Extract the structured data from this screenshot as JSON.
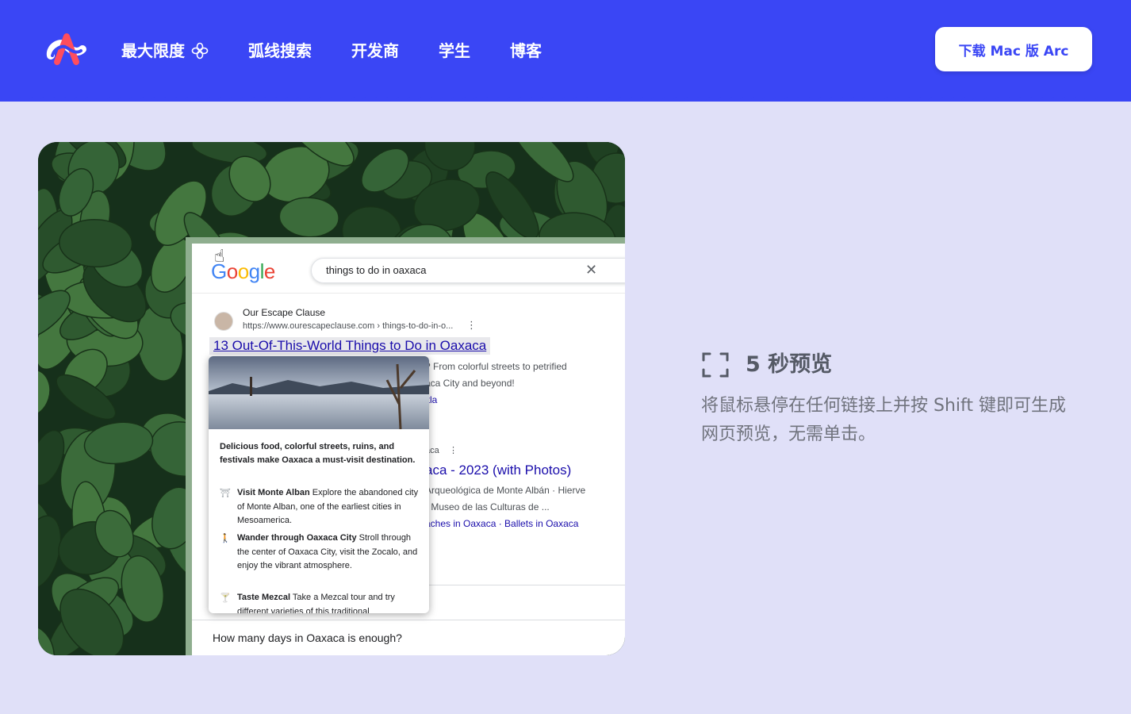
{
  "header": {
    "brand_color": "#3a46f5",
    "nav": [
      {
        "label": "最大限度",
        "icon": "sparkle-icon"
      },
      {
        "label": "弧线搜索"
      },
      {
        "label": "开发商"
      },
      {
        "label": "学生"
      },
      {
        "label": "博客"
      }
    ],
    "download_label": "下载 Mac 版 Arc"
  },
  "screenshot": {
    "search_engine": "Google",
    "query": "things to do in oaxaca",
    "result1": {
      "site_name": "Our Escape Clause",
      "url": "https://www.ourescapeclause.com › things-to-do-in-o...",
      "title": "13 Out-Of-This-World Things to Do in Oaxaca",
      "snippet_line1": "? From colorful streets to petrified",
      "snippet_line2": "aca City and beyond!",
      "snippet_link": "itla"
    },
    "result2": {
      "site_fragment": "aca",
      "title": "aca - 2023 (with Photos)",
      "snippet_line1": "Arqueológica de Monte Albán · Hierve",
      "snippet_line2": "· Museo de las Culturas de ...",
      "links": "aches in Oaxaca · Ballets in Oaxaca"
    },
    "faq_question": "How many days in Oaxaca is enough?",
    "preview": {
      "lead": "Delicious food, colorful streets, ruins, and festivals make Oaxaca a must-visit destination.",
      "items": [
        {
          "title": "Visit Monte Alban",
          "text": "Explore the abandoned city of Monte Alban, one of the earliest cities in Mesoamerica.",
          "icon": "monument-icon"
        },
        {
          "title": "Wander through Oaxaca City",
          "text": "Stroll through the center of Oaxaca City, visit the Zocalo, and enjoy the vibrant atmosphere.",
          "icon": "walking-icon"
        },
        {
          "title": "Taste Mezcal",
          "text": "Take a Mezcal tour and try different varieties of this traditional",
          "icon": "drink-icon"
        }
      ]
    }
  },
  "feature": {
    "icon": "frame-corners-icon",
    "title": "5 秒预览",
    "description": "将鼠标悬停在任何链接上并按 Shift 键即可生成网页预览，无需单击。"
  }
}
